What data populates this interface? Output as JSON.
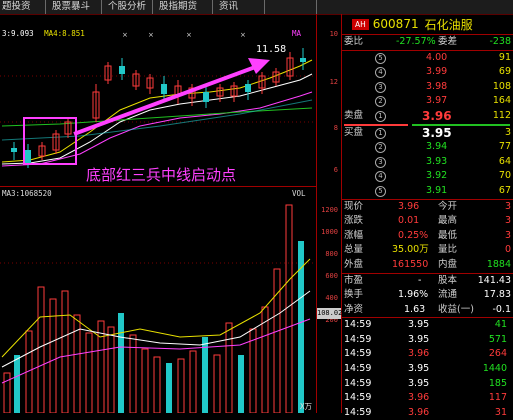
{
  "tabs": [
    "题投资",
    "股票暴斗",
    "个股分析",
    "股指期货",
    "资讯"
  ],
  "chart": {
    "ma_legend": [
      {
        "label": "3:9.093",
        "color": "#ffffff"
      },
      {
        "label": "MA4:8.851",
        "color": "#e8e000"
      },
      {
        "label": "MA",
        "color": "#ff40ff"
      }
    ],
    "target_label": "11.58",
    "annotation": "底部红三兵中线启动点",
    "vol_legend": "MA3:1068520",
    "vol_tag": "VOL",
    "vol_unit": "X万",
    "price_axis": [
      "12",
      "10",
      "8",
      "6"
    ],
    "vol_axis": [
      "1200",
      "1000",
      "800",
      "600",
      "400",
      "200",
      "108.02"
    ]
  },
  "stock": {
    "badge": "AH",
    "code": "600871",
    "name": "石化油服"
  },
  "orderbook": {
    "webi_label": "委比",
    "webi_value": "-27.57%",
    "weicha_label": "委差",
    "weicha_value": "-238",
    "asks": [
      {
        "level": "5",
        "price": "4.00",
        "vol": "91"
      },
      {
        "level": "4",
        "price": "3.99",
        "vol": "69"
      },
      {
        "level": "3",
        "price": "3.98",
        "vol": "108"
      },
      {
        "level": "2",
        "price": "3.97",
        "vol": "164"
      },
      {
        "level": "1",
        "label": "卖盘",
        "price": "3.96",
        "vol": "112"
      }
    ],
    "bids": [
      {
        "level": "1",
        "label": "买盘",
        "price": "3.95",
        "vol": "3"
      },
      {
        "level": "2",
        "price": "3.94",
        "vol": "77"
      },
      {
        "level": "3",
        "price": "3.93",
        "vol": "64"
      },
      {
        "level": "4",
        "price": "3.92",
        "vol": "70"
      },
      {
        "level": "5",
        "price": "3.91",
        "vol": "67"
      }
    ]
  },
  "quote": {
    "rows": [
      {
        "l1": "现价",
        "v1": "3.96",
        "l2": "今开",
        "v2": "3"
      },
      {
        "l1": "涨跌",
        "v1": "0.01",
        "l2": "最高",
        "v2": "3"
      },
      {
        "l1": "涨幅",
        "v1": "0.25%",
        "l2": "最低",
        "v2": "3"
      },
      {
        "l1": "总量",
        "v1": "35.00万",
        "l2": "量比",
        "v2": "0"
      },
      {
        "l1": "外盘",
        "v1": "161550",
        "l2": "内盘",
        "v2": "1884"
      }
    ],
    "rows2": [
      {
        "l1": "市盈",
        "v1": "-",
        "l2": "股本",
        "v2": "141.43"
      },
      {
        "l1": "换手",
        "v1": "1.96%",
        "l2": "流通",
        "v2": "17.83"
      },
      {
        "l1": "净资",
        "v1": "1.63",
        "l2": "收益(一)",
        "v2": "-0.1"
      }
    ]
  },
  "trades": [
    {
      "time": "14:59",
      "price": "3.95",
      "vol": "41",
      "dir": "green"
    },
    {
      "time": "14:59",
      "price": "3.95",
      "vol": "571",
      "dir": "green"
    },
    {
      "time": "14:59",
      "price": "3.96",
      "vol": "264",
      "dir": "red"
    },
    {
      "time": "14:59",
      "price": "3.95",
      "vol": "1440",
      "dir": "green"
    },
    {
      "time": "14:59",
      "price": "3.95",
      "vol": "185",
      "dir": "green"
    },
    {
      "time": "14:59",
      "price": "3.96",
      "vol": "117",
      "dir": "red"
    },
    {
      "time": "14:59",
      "price": "3.96",
      "vol": "31",
      "dir": "red"
    }
  ]
}
